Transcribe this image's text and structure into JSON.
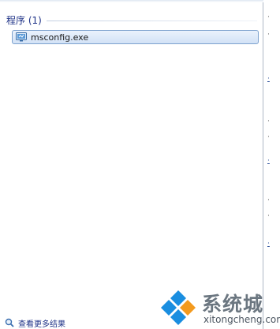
{
  "start_menu": {
    "group": {
      "title": "程序 (1)"
    },
    "results": [
      {
        "label": "msconfig.exe",
        "icon": "system-config-icon"
      }
    ],
    "see_more": {
      "label": "查看更多结果",
      "icon": "search-icon"
    }
  },
  "watermark": {
    "name": "系统城",
    "url": "xitongcheng.com"
  },
  "colors": {
    "group_title": "#1e3287",
    "selection_border": "#7da2ce",
    "selection_fill": "#d2e2f6",
    "panel_border": "#aeb8c6",
    "watermark_blue": "#1a8ee0",
    "watermark_orange": "#f39a1e"
  }
}
